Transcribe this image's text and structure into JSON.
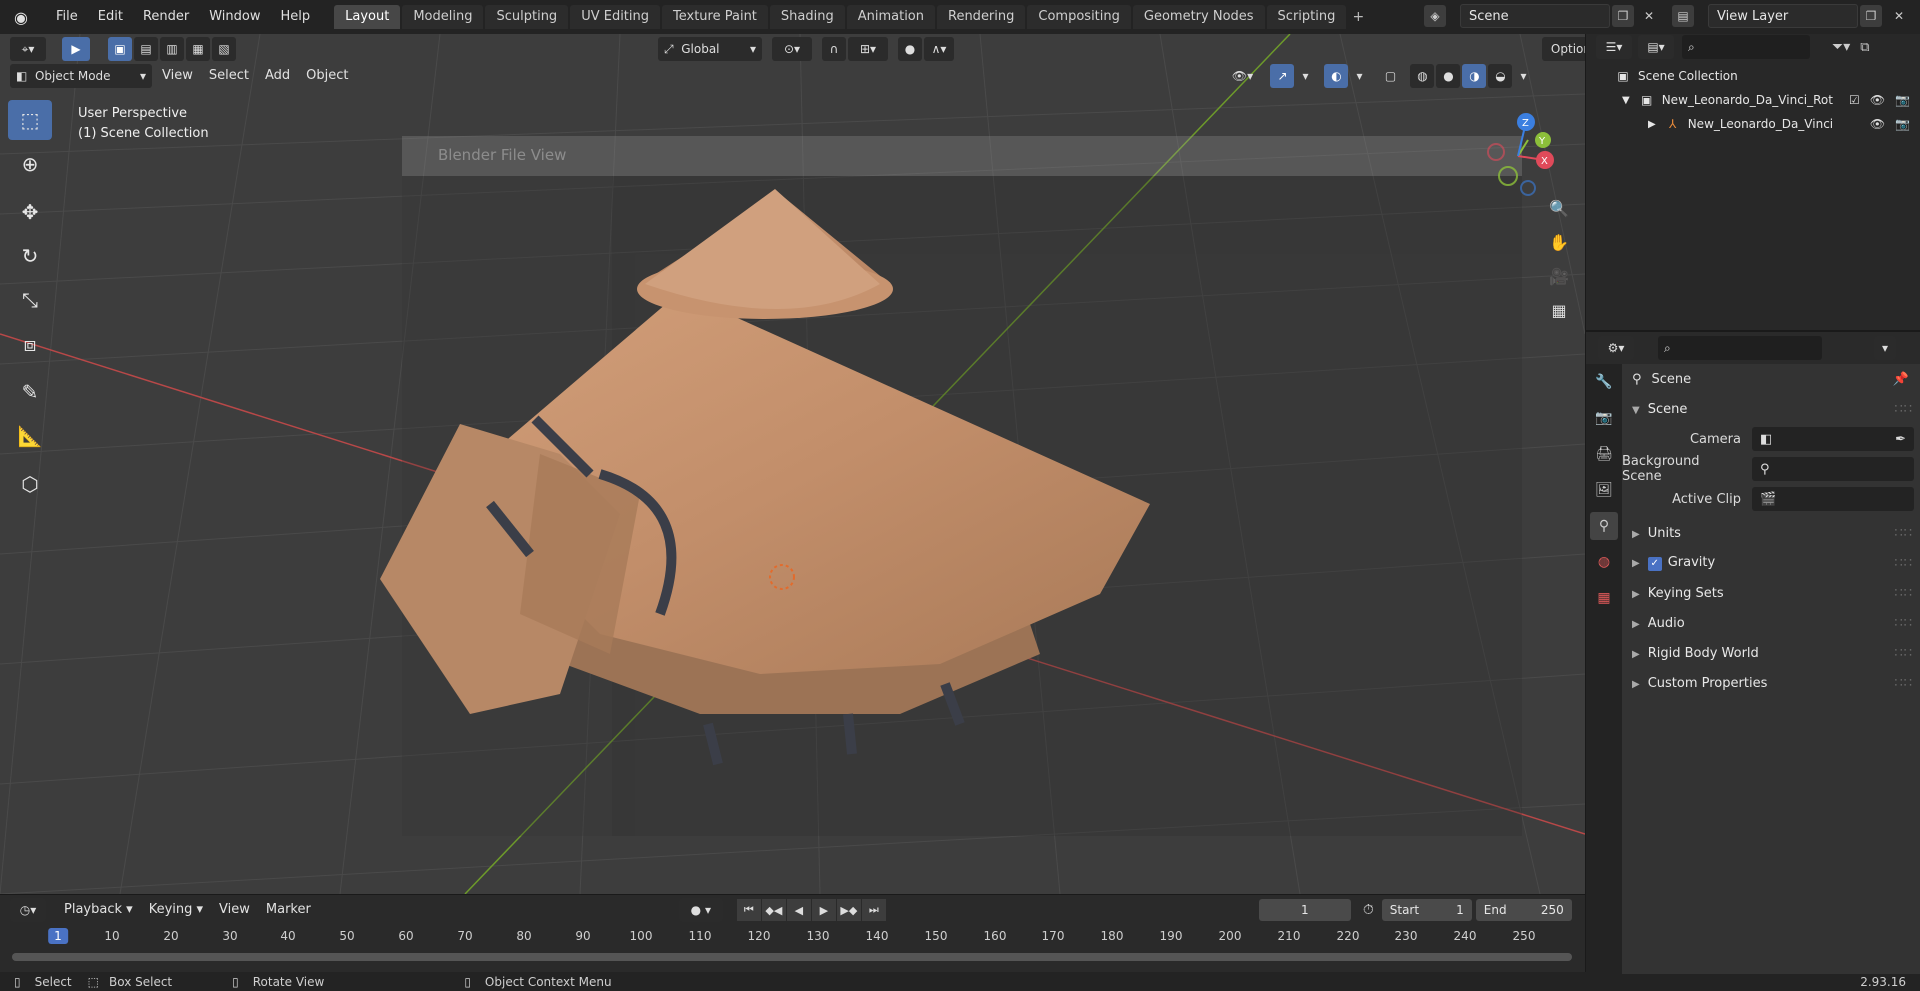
{
  "app": {
    "menus": [
      "File",
      "Edit",
      "Render",
      "Window",
      "Help"
    ],
    "workspaces": [
      "Layout",
      "Modeling",
      "Sculpting",
      "UV Editing",
      "Texture Paint",
      "Shading",
      "Animation",
      "Rendering",
      "Compositing",
      "Geometry Nodes",
      "Scripting"
    ],
    "active_workspace": "Layout",
    "scene_name": "Scene",
    "view_layer": "View Layer"
  },
  "viewport": {
    "mode": "Object Mode",
    "menus": [
      "View",
      "Select",
      "Add",
      "Object"
    ],
    "orientation": "Global",
    "options": "Options",
    "perspective": "User Perspective",
    "collection": "(1) Scene Collection",
    "dialog_title": "Blender File View"
  },
  "timeline": {
    "menus": [
      "Playback",
      "Keying",
      "View",
      "Marker"
    ],
    "current_frame": "1",
    "start_label": "Start",
    "start": "1",
    "end_label": "End",
    "end": "250",
    "ruler": [
      "10",
      "20",
      "30",
      "40",
      "50",
      "60",
      "70",
      "80",
      "90",
      "100",
      "110",
      "120",
      "130",
      "140",
      "150",
      "160",
      "170",
      "180",
      "190",
      "200",
      "210",
      "220",
      "230",
      "240",
      "250"
    ],
    "ruler_current": "1"
  },
  "statusbar": {
    "select": "Select",
    "box_select": "Box Select",
    "rotate_view": "Rotate View",
    "context_menu": "Object Context Menu",
    "version": "2.93.16"
  },
  "outliner": {
    "root": "Scene Collection",
    "items": [
      {
        "label": "New_Leonardo_Da_Vinci_Rot"
      },
      {
        "label": "New_Leonardo_Da_Vinci"
      }
    ]
  },
  "properties": {
    "context": "Scene",
    "panel_scene": "Scene",
    "camera_label": "Camera",
    "background_label": "Background Scene",
    "clip_label": "Active Clip",
    "panels": [
      "Units",
      "Gravity",
      "Keying Sets",
      "Audio",
      "Rigid Body World",
      "Custom Properties"
    ]
  }
}
